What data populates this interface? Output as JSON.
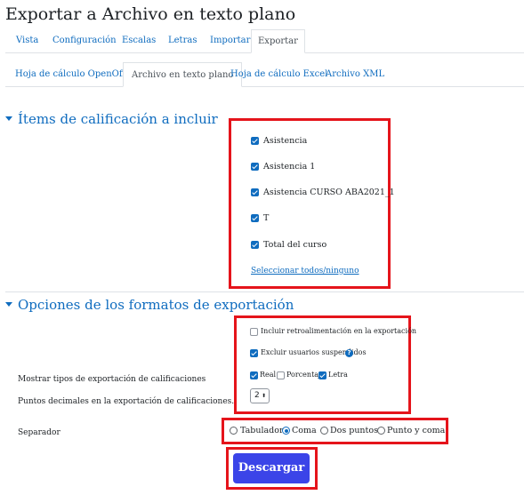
{
  "page": {
    "title": "Exportar a Archivo en texto plano"
  },
  "tabs": [
    {
      "label": "Vista"
    },
    {
      "label": "Configuración"
    },
    {
      "label": "Escalas"
    },
    {
      "label": "Letras"
    },
    {
      "label": "Importar"
    },
    {
      "label": "Exportar",
      "active": true
    }
  ],
  "subtabs": [
    {
      "label": "Hoja de cálculo OpenOffice"
    },
    {
      "label": "Archivo en texto plano",
      "active": true
    },
    {
      "label": "Hoja de cálculo Excel"
    },
    {
      "label": "Archivo XML"
    }
  ],
  "items_section": {
    "heading": "Ítems de calificación a incluir",
    "items": [
      {
        "label": "Asistencia",
        "checked": true
      },
      {
        "label": "Asistencia 1",
        "checked": true
      },
      {
        "label": "Asistencia CURSO ABA2021_1",
        "checked": true
      },
      {
        "label": "T",
        "checked": true
      },
      {
        "label": "Total del curso",
        "checked": true
      }
    ],
    "select_all_link": "Seleccionar todos/ninguno"
  },
  "options_section": {
    "heading": "Opciones de los formatos de exportación",
    "include_feedback": {
      "label": "Incluir retroalimentación en la exportación",
      "checked": false
    },
    "exclude_suspended": {
      "label": "Excluir usuarios suspendidos",
      "checked": true
    },
    "display_types_label": "Mostrar tipos de exportación de calificaciones",
    "display_types": [
      {
        "label": "Real",
        "checked": true
      },
      {
        "label": "Porcentaje",
        "checked": false
      },
      {
        "label": "Letra",
        "checked": true
      }
    ],
    "decimal_points_label": "Puntos decimales en la exportación de calificaciones.",
    "decimal_points_value": "2",
    "separator_label": "Separador",
    "separators": [
      {
        "label": "Tabulador",
        "selected": false
      },
      {
        "label": "Coma",
        "selected": true
      },
      {
        "label": "Dos puntos",
        "selected": false
      },
      {
        "label": "Punto y coma",
        "selected": false
      }
    ]
  },
  "download_button": {
    "label": "Descargar"
  },
  "colors": {
    "link": "#0f6cbf",
    "button": "#3b44e8",
    "highlight_box": "#e5141b"
  }
}
